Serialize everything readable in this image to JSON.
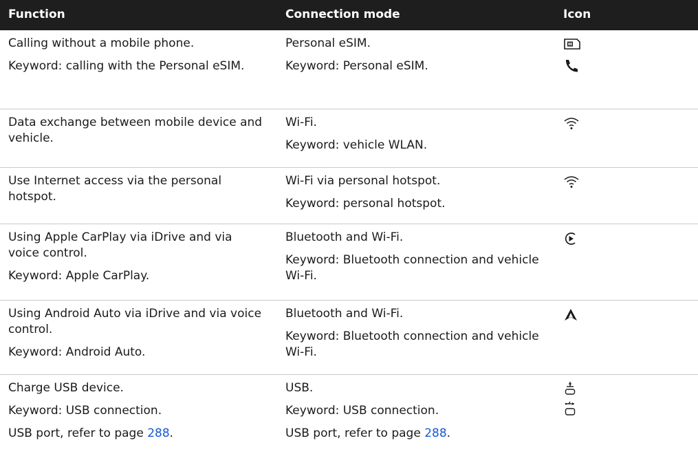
{
  "header": {
    "function": "Function",
    "connection_mode": "Connection mode",
    "icon": "Icon"
  },
  "rows": [
    {
      "function": [
        "Calling without a mobile phone.",
        "Keyword: calling with the Personal eSIM."
      ],
      "mode": [
        "Personal eSIM.",
        "Keyword: Personal eSIM."
      ],
      "icons": [
        "esim-icon",
        "phone-handset-icon"
      ]
    },
    {
      "function": [
        "Data exchange between mobile device and vehicle."
      ],
      "mode": [
        "Wi-Fi.",
        "Keyword: vehicle WLAN."
      ],
      "icons": [
        "wifi-icon"
      ]
    },
    {
      "function": [
        "Use Internet access via the personal hotspot."
      ],
      "mode": [
        "Wi-Fi via personal hotspot.",
        "Keyword: personal hotspot."
      ],
      "icons": [
        "wifi-icon"
      ]
    },
    {
      "function": [
        "Using Apple CarPlay via iDrive and via voice control.",
        "Keyword: Apple CarPlay."
      ],
      "mode": [
        "Bluetooth and Wi-Fi.",
        "Keyword: Bluetooth connection and vehicle Wi-Fi."
      ],
      "icons": [
        "carplay-icon"
      ]
    },
    {
      "function": [
        "Using Android Auto via iDrive and via voice control.",
        "Keyword: Android Auto."
      ],
      "mode": [
        "Bluetooth and Wi-Fi.",
        "Keyword: Bluetooth connection and vehicle Wi-Fi."
      ],
      "icons": [
        "android-auto-icon"
      ]
    },
    {
      "function": [
        "Charge USB device.",
        "Keyword: USB connection.",
        "USB port, refer to page "
      ],
      "mode": [
        "USB.",
        "Keyword: USB connection.",
        "USB port, refer to page "
      ],
      "page_ref": "288",
      "icons": [
        "usb-charge-icon",
        "usb-data-icon"
      ]
    }
  ]
}
